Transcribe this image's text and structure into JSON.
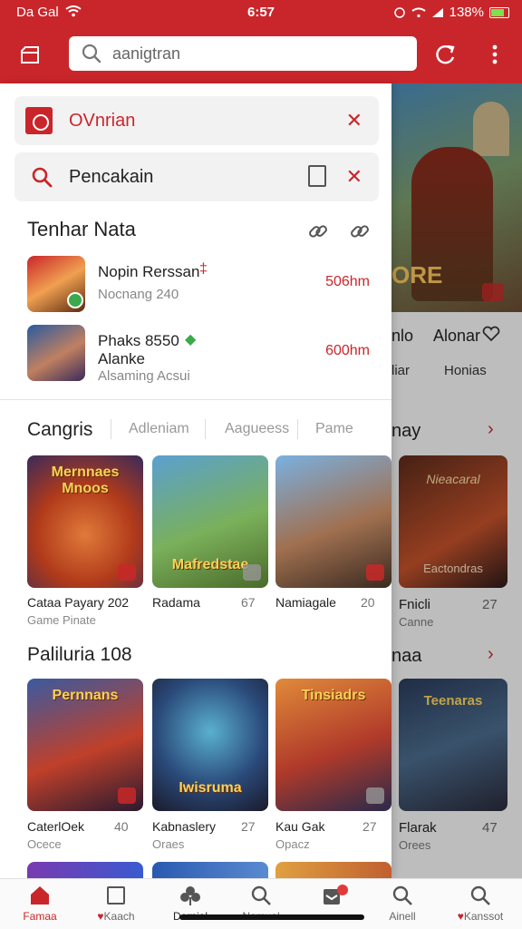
{
  "status_bar": {
    "carrier": "Da Gal",
    "time": "6:57",
    "battery": "138%"
  },
  "top_bar": {
    "search_placeholder": "aanigtran"
  },
  "drawer": {
    "chip_top": {
      "label": "OVnrian"
    },
    "chip_search": {
      "label": "Pencakain"
    },
    "recent": {
      "title": "Tenhar Nata",
      "items": [
        {
          "name": "Nopin Rerssan",
          "sub": "Nocnang 240",
          "duration": "506hm"
        },
        {
          "name": "Phaks 8550",
          "name2": "Alanke",
          "sub": "Alsaming Acsui",
          "duration": "600hm"
        }
      ]
    },
    "categories": {
      "title": "Cangris",
      "tabs": [
        "Adleniam",
        "Aagueess",
        "Pame"
      ]
    },
    "row1": [
      {
        "art": "Mernnaes Mnoos",
        "title": "Cataa Payary 202",
        "sub": "Game Pinate",
        "num": ""
      },
      {
        "art": "Mafredstae",
        "title": "Radama",
        "sub": "",
        "num": "67"
      },
      {
        "art": "",
        "title": "Namiagale",
        "sub": "",
        "num": "20"
      }
    ],
    "section2": {
      "title": "Paliluria 108"
    },
    "row2": [
      {
        "art": "Pernnans",
        "title": "CaterlOek",
        "sub": "Ocece",
        "num": "40"
      },
      {
        "art": "Iwisruma",
        "title": "Kabnaslery",
        "sub": "Oraes",
        "num": "27"
      },
      {
        "art": "Tinsiadrs",
        "title": "Kau Gak",
        "sub": "Opacz",
        "num": "27"
      }
    ]
  },
  "background": {
    "hero_text": "ORE",
    "tabs1": [
      "nlo",
      "Alonar"
    ],
    "tabs2": [
      "liar",
      "Honias"
    ],
    "head1": "nay",
    "card1": {
      "art_top": "Nieacaral",
      "art_bottom": "Eactondras",
      "title": "Fnicli",
      "sub": "Canne",
      "num": "27"
    },
    "head2": "naa",
    "card2": {
      "art": "Teenaras",
      "title": "Flarak",
      "sub": "Orees",
      "num": "47"
    }
  },
  "bottom_nav": [
    {
      "label": "Famaa"
    },
    {
      "label": "Kaach"
    },
    {
      "label": "Dernial"
    },
    {
      "label": "Namual"
    },
    {
      "label": ""
    },
    {
      "label": "Ainell"
    },
    {
      "label": "Kanssot"
    }
  ],
  "colors": {
    "brand_red": "#c9262b",
    "green_check": "#3aaa4a"
  }
}
